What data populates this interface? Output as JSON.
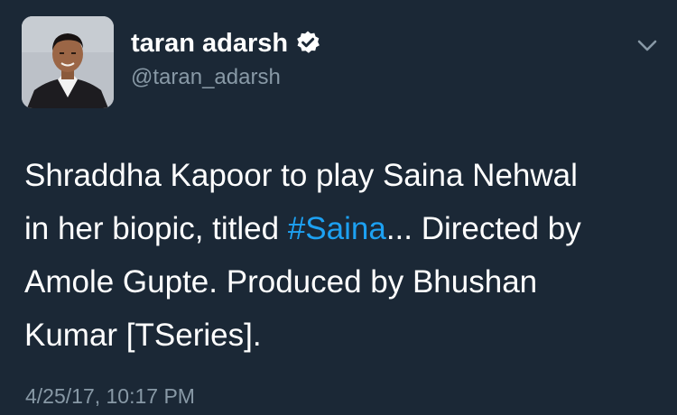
{
  "tweet": {
    "author": {
      "display_name": "taran adarsh",
      "handle": "@taran_adarsh",
      "verified": true,
      "avatar_icon": "profile-photo"
    },
    "menu_icon": "chevron-down-icon",
    "text_lines": [
      {
        "before": "Shraddha Kapoor to play Saina Nehwal",
        "hashtag": "",
        "after": ""
      },
      {
        "before": "in her biopic, titled ",
        "hashtag": "#Saina",
        "after": "... Directed by"
      },
      {
        "before": "Amole Gupte. Produced by Bhushan",
        "hashtag": "",
        "after": ""
      },
      {
        "before": "Kumar [TSeries].",
        "hashtag": "",
        "after": ""
      }
    ],
    "timestamp": "4/25/17, 10:17 PM"
  },
  "colors": {
    "background": "#1b2836",
    "text": "#ffffff",
    "secondary_text": "#8899a6",
    "link": "#1da1f2"
  }
}
